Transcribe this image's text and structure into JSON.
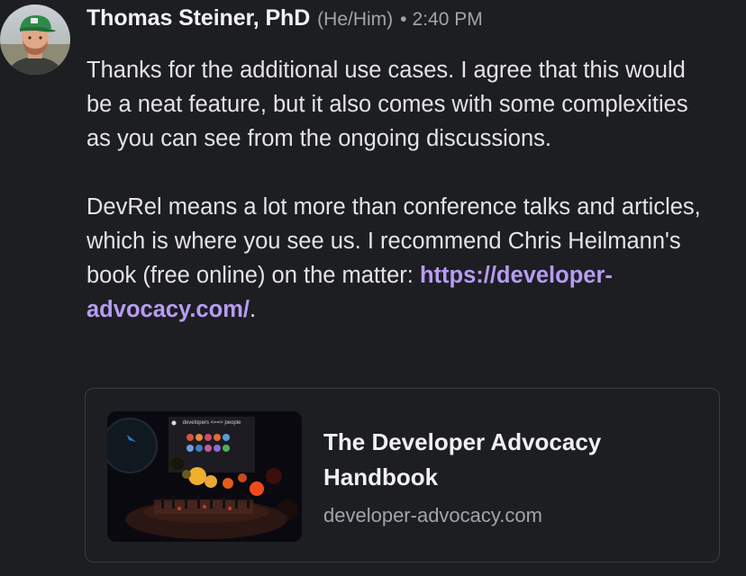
{
  "post": {
    "author": "Thomas Steiner, PhD",
    "pronouns": "(He/Him)",
    "separator": "•",
    "time": "2:40 PM",
    "paragraph1": "Thanks for the additional use cases. I agree that this would be a neat feature, but it also comes with some complexities as you can see from the ongoing discussions.",
    "paragraph2_text": "DevRel means a lot more than conference talks and articles, which is where you see us. I recommend Chris Heilmann's book (free online) on the matter: ",
    "paragraph2_link": "https://developer-advocacy.com/",
    "paragraph2_end": "."
  },
  "preview": {
    "title": "The Developer Advocacy Handbook",
    "domain": "developer-advocacy.com",
    "thumbnail_slide_text": "developers <==> people"
  },
  "colors": {
    "background": "#1d1e22",
    "link": "#b79cf2",
    "muted": "#a3a4a9",
    "card_border": "#3b3c42"
  }
}
